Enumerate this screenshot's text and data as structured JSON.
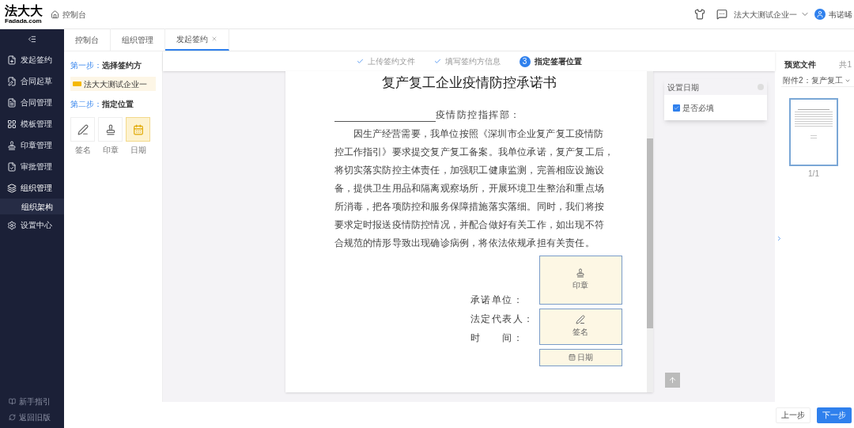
{
  "header": {
    "logo": "法大大",
    "logo_sub": "Fadada.com",
    "breadcrumb": "控制台",
    "company": "法大大测试企业一",
    "user": "韦诺晞"
  },
  "sidebar": {
    "items": [
      {
        "label": "发起签约",
        "selected": false
      },
      {
        "label": "合同起草",
        "selected": false
      },
      {
        "label": "合同管理",
        "selected": false
      },
      {
        "label": "模板管理",
        "selected": false
      },
      {
        "label": "印章管理",
        "selected": false
      },
      {
        "label": "审批管理",
        "selected": false
      },
      {
        "label": "组织管理",
        "selected": false,
        "expanded": true,
        "children": [
          {
            "label": "组织架构",
            "selected": true
          }
        ]
      },
      {
        "label": "设置中心",
        "selected": false
      }
    ],
    "footer": [
      {
        "label": "新手指引"
      },
      {
        "label": "返回旧版"
      }
    ]
  },
  "tabs": [
    {
      "label": "控制台",
      "selected": false,
      "closable": false
    },
    {
      "label": "组织管理",
      "selected": false,
      "closable": false
    },
    {
      "label": "发起签约",
      "selected": true,
      "closable": true
    }
  ],
  "left_panel": {
    "step1": {
      "prefix": "第一步：",
      "title": "选择签约方"
    },
    "party": "法大大测试企业一",
    "step2": {
      "prefix": "第二步：",
      "title": "指定位置"
    },
    "tools": [
      {
        "label": "签名",
        "kind": "signature",
        "selected": false
      },
      {
        "label": "印章",
        "kind": "seal",
        "selected": false
      },
      {
        "label": "日期",
        "kind": "date",
        "selected": true
      }
    ]
  },
  "steps": [
    {
      "label": "上传签约文件",
      "completed": true,
      "selected": false
    },
    {
      "label": "填写签约方信息",
      "completed": true,
      "selected": false
    },
    {
      "number": "3",
      "label": "指定签署位置",
      "completed": false,
      "selected": true
    }
  ],
  "document": {
    "title": "复产复工企业疫情防控承诺书",
    "addressee": "疫情防控指挥部：",
    "lines": [
      "因生产经营需要，我单位按照《深圳市企业复产复工疫情防",
      "控工作指引》要求提交复产复工备案。我单位承诺，复产复工后，",
      "将切实落实防控主体责任，加强职工健康监测，完善相应设施设",
      "备，提供卫生用品和隔离观察场所，开展环境卫生整治和重点场",
      "所消毒，把各项防控和服务保障措施落实落细。同时，我们将按",
      "要求定时报送疫情防控情况，并配合做好有关工作，如出现不符",
      "合规范的情形导致出现确诊病例，将依法依规承担有关责任。"
    ],
    "signoff": [
      "承诺单位：",
      "法定代表人：",
      "时　　间："
    ],
    "fields": [
      {
        "kind": "seal",
        "label": "印章"
      },
      {
        "kind": "signature",
        "label": "签名"
      },
      {
        "kind": "date",
        "label": "日期"
      }
    ]
  },
  "settings_popup": {
    "title": "设置日期",
    "option": "是否必填",
    "checked": true
  },
  "preview": {
    "title": "预览文件",
    "count": "共1",
    "file": "附件2：复产复工",
    "page": "1/1"
  },
  "footer": {
    "buttons": [
      {
        "label": "上一步",
        "kind": "secondary"
      },
      {
        "label": "下一步",
        "kind": "primary"
      }
    ]
  }
}
